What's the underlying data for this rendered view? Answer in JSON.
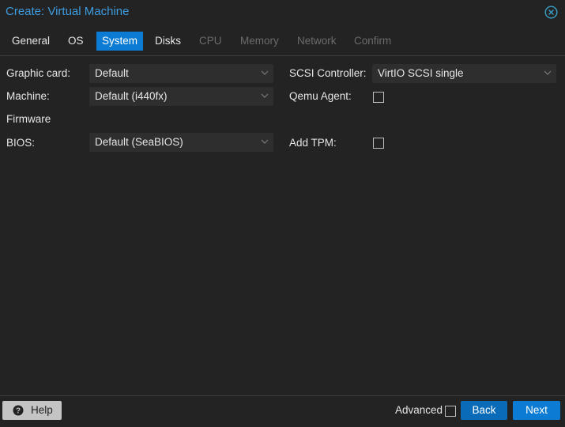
{
  "window": {
    "title": "Create: Virtual Machine",
    "close_icon": "close-circle-icon"
  },
  "tabs": [
    {
      "label": "General",
      "state": "enabled"
    },
    {
      "label": "OS",
      "state": "enabled"
    },
    {
      "label": "System",
      "state": "active"
    },
    {
      "label": "Disks",
      "state": "enabled"
    },
    {
      "label": "CPU",
      "state": "disabled"
    },
    {
      "label": "Memory",
      "state": "disabled"
    },
    {
      "label": "Network",
      "state": "disabled"
    },
    {
      "label": "Confirm",
      "state": "disabled"
    }
  ],
  "form": {
    "graphic_card": {
      "label": "Graphic card:",
      "value": "Default"
    },
    "machine": {
      "label": "Machine:",
      "value": "Default (i440fx)"
    },
    "firmware_heading": "Firmware",
    "bios": {
      "label": "BIOS:",
      "value": "Default (SeaBIOS)"
    },
    "scsi_controller": {
      "label": "SCSI Controller:",
      "value": "VirtIO SCSI single"
    },
    "qemu_agent": {
      "label": "Qemu Agent:",
      "checked": false
    },
    "add_tpm": {
      "label": "Add TPM:",
      "checked": false
    }
  },
  "footer": {
    "help_label": "Help",
    "help_icon": "question-circle-icon",
    "advanced_label": "Advanced",
    "advanced_checked": false,
    "back_label": "Back",
    "next_label": "Next"
  },
  "colors": {
    "accent": "#0b7bd3",
    "title": "#3d9be0",
    "background": "#232323",
    "field": "#2e2e2e"
  }
}
